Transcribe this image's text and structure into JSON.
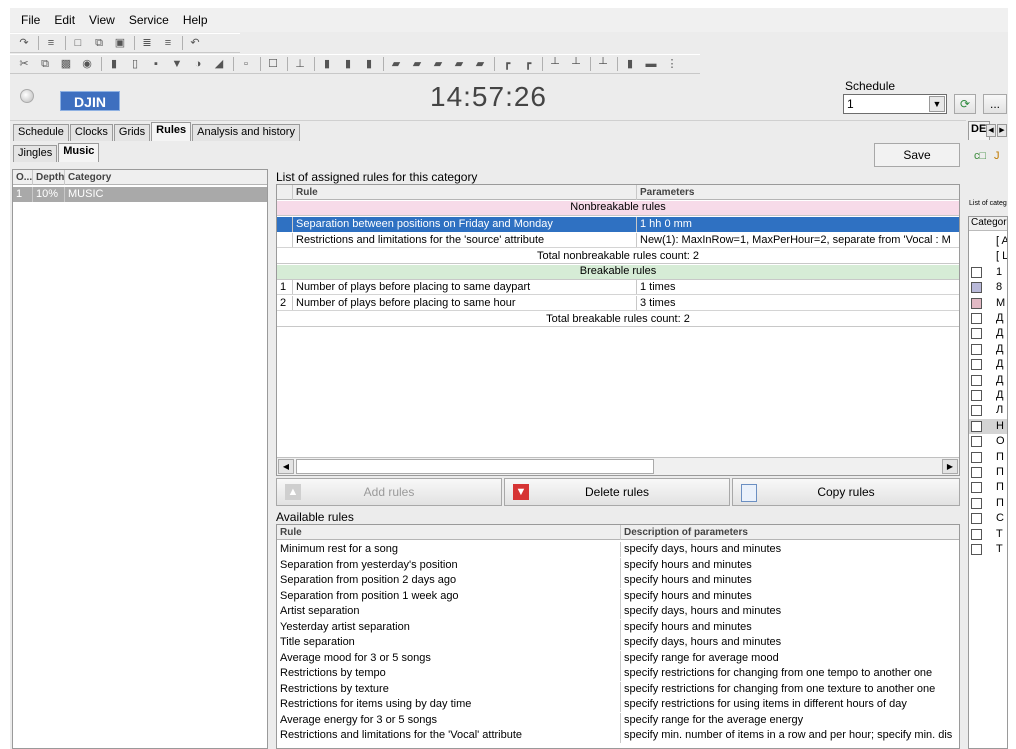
{
  "menu": [
    "File",
    "Edit",
    "View",
    "Service",
    "Help"
  ],
  "clock": "14:57:26",
  "logo_text": "DJIN",
  "schedule": {
    "label": "Schedule",
    "value": "1",
    "more_label": "..."
  },
  "main_tabs": [
    "Schedule",
    "Clocks",
    "Grids",
    "Rules",
    "Analysis and history"
  ],
  "sub_tabs": [
    "Jingles",
    "Music"
  ],
  "save_label": "Save",
  "category_table": {
    "headers": [
      "O...",
      "Depth",
      "Category"
    ],
    "rows": [
      {
        "o": "1",
        "depth": "10%",
        "category": "MUSIC"
      }
    ]
  },
  "assigned": {
    "title": "List of assigned rules for this category",
    "headers": {
      "rule": "Rule",
      "params": "Parameters"
    },
    "nonbreakable_title": "Nonbreakable rules",
    "nonbreakable": [
      {
        "n": "",
        "rule": "Separation between positions on Friday and Monday",
        "params": "1 hh  0 mm"
      },
      {
        "n": "",
        "rule": "Restrictions and limitations for the 'source' attribute",
        "params": "New(1): MaxInRow=1, MaxPerHour=2, separate from 'Vocal : M"
      }
    ],
    "nonbreakable_total": "Total nonbreakable rules count: 2",
    "breakable_title": "Breakable rules",
    "breakable": [
      {
        "n": "1",
        "rule": "Number of plays before placing to same daypart",
        "params": "1 times"
      },
      {
        "n": "2",
        "rule": "Number of plays before placing to same hour",
        "params": "3 times"
      }
    ],
    "breakable_total": "Total breakable rules count: 2"
  },
  "actions": {
    "add": "Add rules",
    "delete": "Delete rules",
    "copy": "Copy rules"
  },
  "available": {
    "title": "Available rules",
    "headers": {
      "rule": "Rule",
      "desc": "Description of parameters"
    },
    "rows": [
      {
        "rule": "Minimum rest for a song",
        "desc": "specify days, hours and minutes"
      },
      {
        "rule": "Separation from yesterday's position",
        "desc": "specify hours and minutes"
      },
      {
        "rule": "Separation from position 2 days ago",
        "desc": "specify hours and minutes"
      },
      {
        "rule": "Separation from position 1 week ago",
        "desc": "specify hours and minutes"
      },
      {
        "rule": "Artist separation",
        "desc": "specify days, hours and minutes"
      },
      {
        "rule": "Yesterday artist separation",
        "desc": "specify hours and minutes"
      },
      {
        "rule": "Title separation",
        "desc": "specify days, hours and minutes"
      },
      {
        "rule": "Average mood for 3 or 5 songs",
        "desc": "specify range for average mood"
      },
      {
        "rule": "Restrictions by tempo",
        "desc": "specify restrictions for changing from one tempo to another one"
      },
      {
        "rule": "Restrictions by texture",
        "desc": "specify restrictions for changing from one texture to another one"
      },
      {
        "rule": "Restrictions for items using by day time",
        "desc": "specify restrictions for using items in different hours of day"
      },
      {
        "rule": "Average energy for 3 or 5 songs",
        "desc": "specify range for the average energy"
      },
      {
        "rule": "Restrictions and limitations for the 'Vocal' attribute",
        "desc": "specify min. number of items in a row and per hour; specify min. dis"
      }
    ]
  },
  "right_panel": {
    "tab": "DE",
    "list_label": "List of categ",
    "header": "Categor",
    "items": [
      "[ A",
      "[ L",
      "1",
      "8",
      "M",
      "Д",
      "Д",
      "Д",
      "Д",
      "Д",
      "Д",
      "Л",
      "H",
      "O",
      "П",
      "П",
      "П",
      "П",
      "C",
      "T",
      "T"
    ]
  }
}
